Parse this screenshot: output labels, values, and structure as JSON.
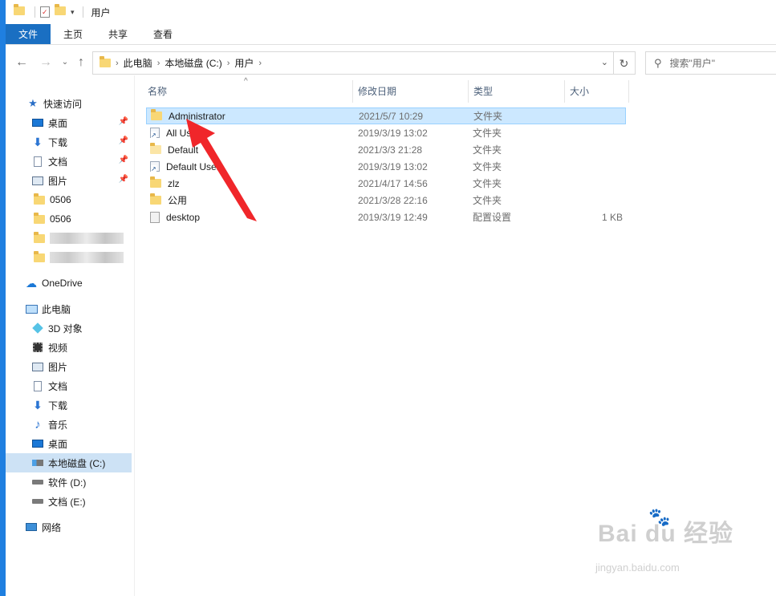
{
  "titlebar": {
    "title": "用户"
  },
  "ribbon": {
    "tabs": [
      "文件",
      "主页",
      "共享",
      "查看"
    ]
  },
  "address": {
    "crumbs": [
      "此电脑",
      "本地磁盘 (C:)",
      "用户"
    ],
    "search_placeholder": "搜索\"用户\""
  },
  "navpane": {
    "quick_access": "快速访问",
    "quick_items": [
      "桌面",
      "下载",
      "文档",
      "图片",
      "0506",
      "0506"
    ],
    "onedrive": "OneDrive",
    "this_pc": "此电脑",
    "pc_items": [
      "3D 对象",
      "视频",
      "图片",
      "文档",
      "下载",
      "音乐",
      "桌面",
      "本地磁盘 (C:)",
      "软件 (D:)",
      "文档 (E:)"
    ],
    "network": "网络"
  },
  "columns": {
    "name": "名称",
    "date": "修改日期",
    "type": "类型",
    "size": "大小"
  },
  "rows": [
    {
      "name": "Administrator",
      "date": "2021/5/7 10:29",
      "type": "文件夹",
      "size": "",
      "icon": "folder-icon"
    },
    {
      "name": "All Users",
      "date": "2019/3/19 13:02",
      "type": "文件夹",
      "size": "",
      "icon": "shortcut-folder-icon"
    },
    {
      "name": "Default",
      "date": "2021/3/3 21:28",
      "type": "文件夹",
      "size": "",
      "icon": "folder-light-icon"
    },
    {
      "name": "Default User",
      "date": "2019/3/19 13:02",
      "type": "文件夹",
      "size": "",
      "icon": "shortcut-folder-icon"
    },
    {
      "name": "zlz",
      "date": "2021/4/17 14:56",
      "type": "文件夹",
      "size": "",
      "icon": "folder-icon"
    },
    {
      "name": "公用",
      "date": "2021/3/28 22:16",
      "type": "文件夹",
      "size": "",
      "icon": "folder-icon"
    },
    {
      "name": "desktop",
      "date": "2019/3/19 12:49",
      "type": "配置设置",
      "size": "1 KB",
      "icon": "ini-file-icon"
    }
  ],
  "watermark": {
    "brand": "Bai du 经验",
    "url": "jingyan.baidu.com"
  },
  "colors": {
    "accent": "#1a6fc2",
    "selection": "#cce8ff",
    "annotation_arrow": "#f0262a"
  }
}
